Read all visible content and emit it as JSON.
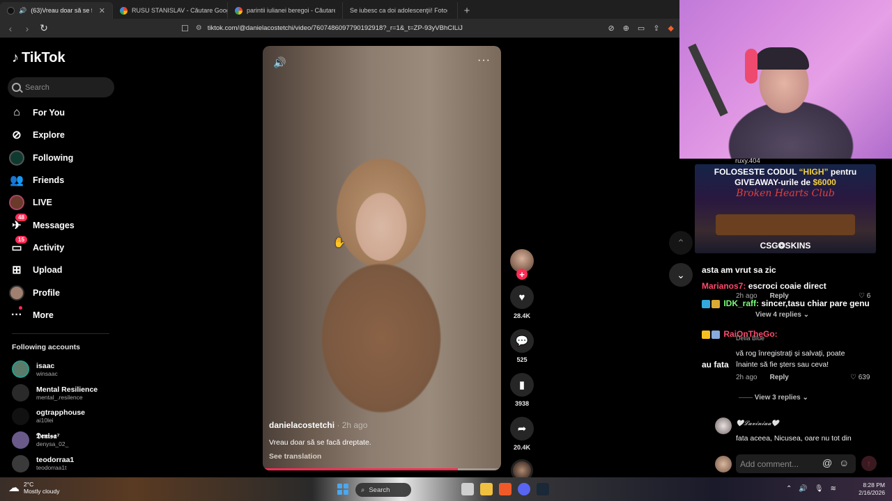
{
  "browser": {
    "tabs": [
      {
        "title": "(63)Vreau doar să se facă dre",
        "active": true
      },
      {
        "title": "RUSU STANISLAV - Căutare Google",
        "active": false
      },
      {
        "title": "parintii iulianei beregoi - Căutare Goo",
        "active": false
      },
      {
        "title": "Se iubesc ca doi adolescenţii! Fotogra",
        "active": false
      }
    ],
    "url": "tiktok.com/@danielacostetchi/video/7607486097790192918?_r=1&_t=ZP-93yVBhCILiJ"
  },
  "tiktok": {
    "logo": "TikTok",
    "search_placeholder": "Search",
    "nav": [
      {
        "label": "For You",
        "icon": "home-icon"
      },
      {
        "label": "Explore",
        "icon": "compass-icon"
      },
      {
        "label": "Following",
        "icon": "following-avatar-icon"
      },
      {
        "label": "Friends",
        "icon": "friends-icon"
      },
      {
        "label": "LIVE",
        "icon": "live-icon"
      },
      {
        "label": "Messages",
        "icon": "messages-icon",
        "badge": "48"
      },
      {
        "label": "Activity",
        "icon": "activity-icon",
        "badge": "15"
      },
      {
        "label": "Upload",
        "icon": "upload-icon"
      },
      {
        "label": "Profile",
        "icon": "profile-avatar-icon"
      },
      {
        "label": "More",
        "icon": "more-icon"
      }
    ],
    "following_title": "Following accounts",
    "following": [
      {
        "name": "isaac",
        "user": "winsaac",
        "color": "#5a7a6a"
      },
      {
        "name": "Mental Resilience",
        "user": "mental_.resilence",
        "color": "#2a2a2a"
      },
      {
        "name": "ogtrapphouse",
        "user": "ai10lei",
        "color": "#111111"
      },
      {
        "name": "𝕯𝖊𝖓𝖎𝖘𝖆⁷",
        "user": "denysa_02_",
        "color": "#6a5a8a"
      },
      {
        "name": "teodorraa1",
        "user": "teodorraa1t",
        "color": "#3a3a3a"
      }
    ],
    "video": {
      "author": "danielacostetchi",
      "time": "· 2h ago",
      "caption": "Vreau doar să se facă dreptate.",
      "see_translation": "See translation",
      "progress": 0.82
    },
    "actions": {
      "likes": "28.4K",
      "comments": "525",
      "saves": "3938",
      "shares": "20.4K"
    }
  },
  "stream": {
    "chat_top_user": "ruxy.404",
    "promo": {
      "line1_pre": "FOLOSESTE CODUL",
      "code": "“HIGH”",
      "line1_post": "pentru",
      "line2_pre": "GIVEAWAY-urile de",
      "amount": "$6000",
      "club": "Broken Hearts Club",
      "brand": "CSG❂SKINS"
    },
    "chat": [
      {
        "text": "asta am vrut sa zic",
        "name": "",
        "color": "#ffffff"
      },
      {
        "name": "Marianos7:",
        "text": "escroci coaie direct",
        "color": "#ff4a6a"
      },
      {
        "name": "IDK_raff:",
        "text": "sincer,tasu chiar pare genu",
        "color": "#7aff7a"
      },
      {
        "name": "RaiOnTheGo:",
        "text": "",
        "color": "#ff4a6a"
      },
      {
        "name": "",
        "text": "au fata",
        "color": "#ffffff"
      }
    ]
  },
  "comments": {
    "c1_time": "2h ago",
    "c1_reply": "Reply",
    "c1_likes": "6",
    "view4": "View 4 replies ⌄",
    "deliablue": "Delia Blue",
    "c2_text": "vă rog înregistrați și salvați, poate înainte să fie șters sau ceva!",
    "c2_time": "2h ago",
    "c2_reply": "Reply",
    "c2_likes": "639",
    "view3": "View 3 replies ⌄",
    "c3_user": "🤍𝓛𝓪𝓿𝓲𝓷𝓲𝓪𝓪🤍",
    "c3_text": "fata aceea, Nicusea, oare nu tot din",
    "add_placeholder": "Add comment..."
  },
  "taskbar": {
    "temp": "2°C",
    "weather": "Mostly cloudy",
    "search": "Search",
    "time": "8:28 PM",
    "date": "2/16/2026"
  }
}
